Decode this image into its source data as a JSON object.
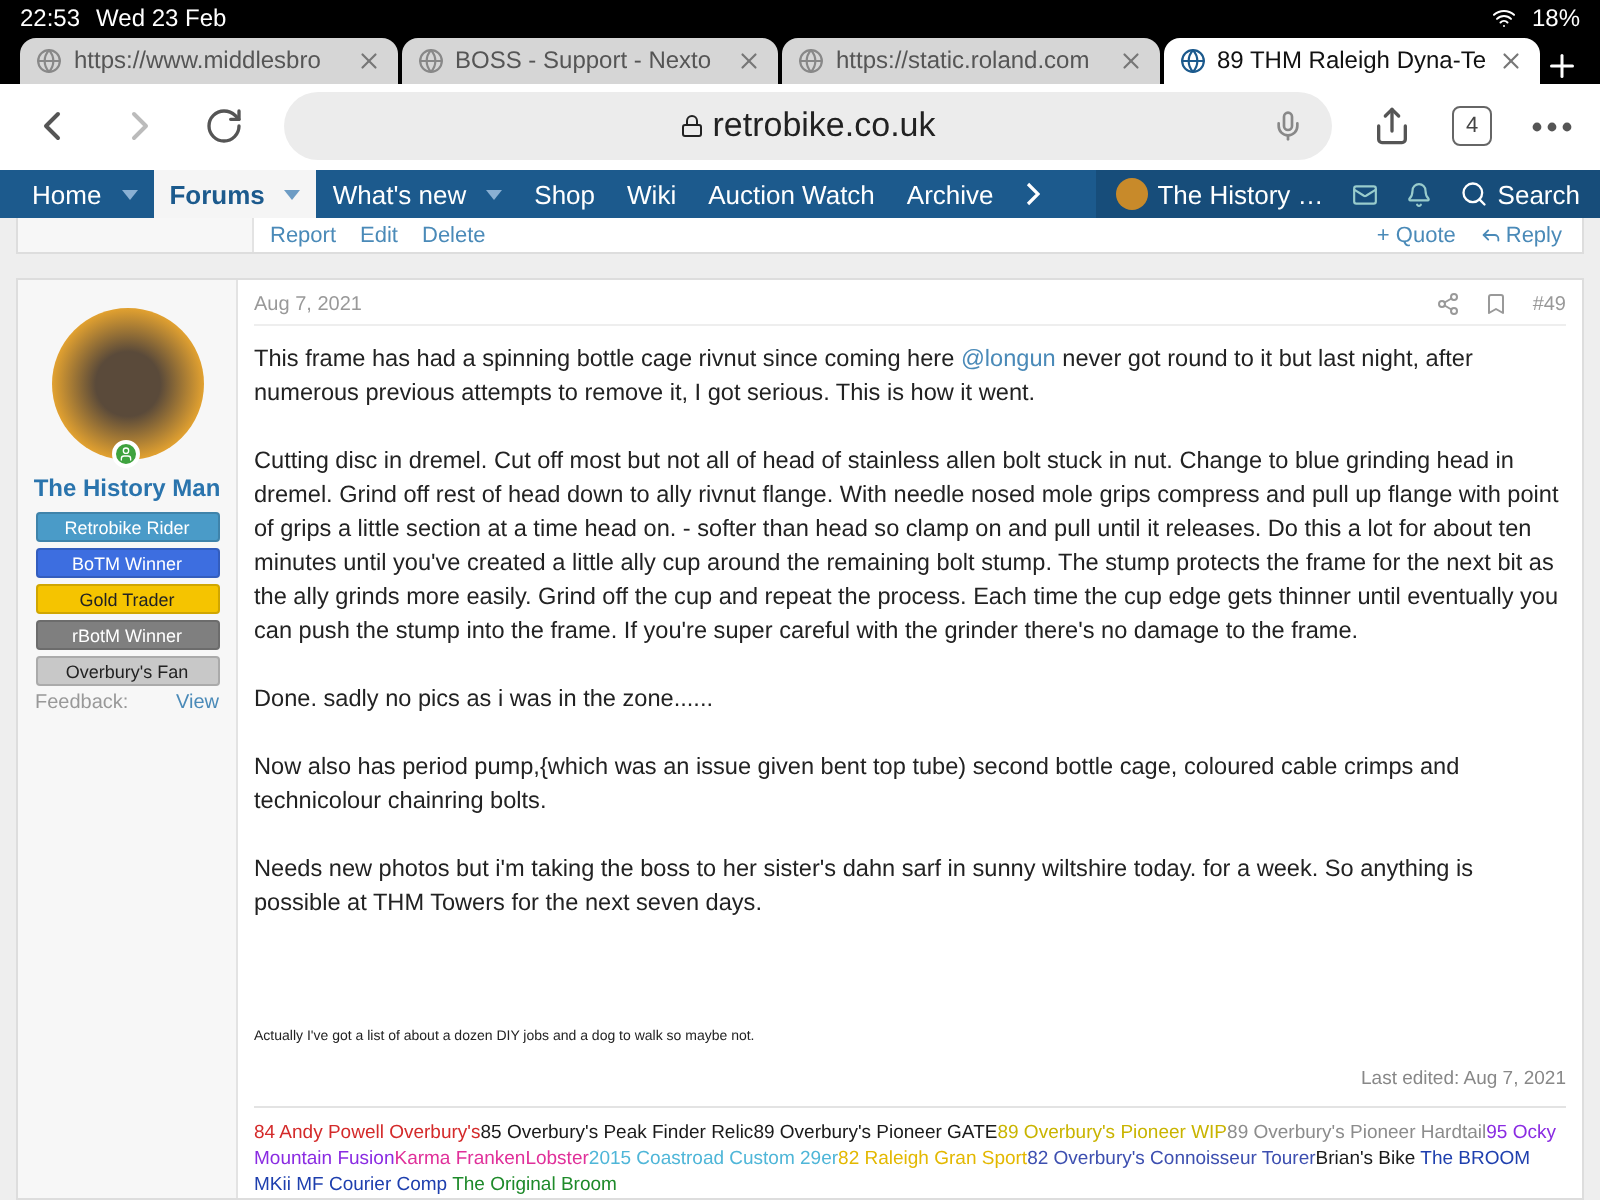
{
  "status_bar": {
    "time": "22:53",
    "date": "Wed 23 Feb",
    "battery": "18%"
  },
  "tabs": [
    {
      "title": "https://www.middlesbro",
      "selected": false
    },
    {
      "title": "BOSS - Support - Nexto",
      "selected": false
    },
    {
      "title": "https://static.roland.com",
      "selected": false
    },
    {
      "title": "89 THM Raleigh Dyna-Te",
      "selected": true
    }
  ],
  "address_bar": {
    "url": "retrobike.co.uk",
    "tab_count": "4"
  },
  "nav": {
    "items": [
      {
        "label": "Home",
        "selected": false,
        "dropdown": true
      },
      {
        "label": "Forums",
        "selected": true,
        "dropdown": true
      },
      {
        "label": "What's new",
        "selected": false,
        "dropdown": true
      },
      {
        "label": "Shop",
        "selected": false,
        "dropdown": false
      },
      {
        "label": "Wiki",
        "selected": false,
        "dropdown": false
      },
      {
        "label": "Auction Watch",
        "selected": false,
        "dropdown": false
      },
      {
        "label": "Archive",
        "selected": false,
        "dropdown": false
      }
    ],
    "user": "The History …",
    "search": "Search"
  },
  "previous_post": {
    "actions": [
      "Report",
      "Edit",
      "Delete"
    ],
    "quote": "+ Quote",
    "reply": "Reply"
  },
  "post": {
    "author": "The History Man",
    "badges": [
      {
        "label": "Retrobike Rider",
        "color": "#4a9bc8"
      },
      {
        "label": "BoTM Winner",
        "color": "#3d6ee0"
      },
      {
        "label": "Gold Trader",
        "color": "#f5c400"
      },
      {
        "label": "rBotM Winner",
        "color": "#7f7f7f"
      },
      {
        "label": "Overbury's Fan",
        "color": "#c8c8c8"
      }
    ],
    "feedback_label": "Feedback:",
    "feedback_link": "View",
    "date": "Aug 7, 2021",
    "number": "#49",
    "paragraphs": [
      {
        "before": "This frame has had a spinning bottle cage rivnut since coming here ",
        "mention": "@longun",
        "after": " never got round to it but last night, after numerous previous attempts to remove it, I got serious. This is how it went."
      },
      {
        "before": "Cutting disc in dremel. Cut off most but not all of head of stainless allen bolt stuck in nut. Change to blue grinding head in dremel. Grind off rest of head down to ally rivnut flange. With needle nosed mole grips compress and pull up flange with point of grips a little section at a time head on. - softer than head so clamp on and pull until it releases. Do this a lot for about ten minutes until you've created a little ally cup around the remaining bolt stump. The stump protects the frame for the next bit as the ally grinds more easily. Grind off the cup and repeat the process. Each time the cup edge gets thinner until eventually you can push the stump into the frame. If you're super careful with the grinder there's no damage to the frame."
      },
      {
        "before": "Done. sadly no pics as i was in the zone......"
      },
      {
        "before": "Now also has period pump,{which was an issue given bent top tube) second bottle cage, coloured cable crimps and technicolour chainring bolts."
      },
      {
        "before": "Needs new photos but i'm taking the boss to her sister's dahn sarf in sunny wiltshire today. for a week. So anything is possible at THM Towers for the next seven days."
      }
    ],
    "small_note": "Actually I've got a list of about a dozen DIY jobs and a dog to walk so maybe not.",
    "last_edited": "Last edited: Aug 7, 2021",
    "signature": [
      {
        "text": "84 Andy Powell Overbury's",
        "color": "#d42a2a"
      },
      {
        "text": "85 Overbury's Peak Finder Relic",
        "color": "#1a1a1a"
      },
      {
        "text": "89 Overbury's Pioneer GATE",
        "color": "#1a1a1a"
      },
      {
        "text": "89 Overbury's Pioneer WIP",
        "color": "#c9b400"
      },
      {
        "text": "89 Overbury's Pioneer Hardtail",
        "color": "#8c8c8c"
      },
      {
        "text": "95 Ocky Mountain Fusion",
        "color": "#8a2be2"
      },
      {
        "text": "Karma FrankenLobster",
        "color": "#e0309a"
      },
      {
        "text": "2015 Coastroad Custom 29er",
        "color": "#4fb6d8"
      },
      {
        "text": "82 Raleigh Gran Sport",
        "color": "#e3b800"
      },
      {
        "text": "82 Overbury's Connoisseur Tourer",
        "color": "#3d4fb0"
      },
      {
        "text": "Brian's Bike",
        "color": "#1a1a1a"
      },
      {
        "text": " The BROOM MKii MF Courier Comp",
        "color": "#1e3fae"
      },
      {
        "text": " The Original Broom",
        "color": "#1e8a2a"
      }
    ]
  }
}
